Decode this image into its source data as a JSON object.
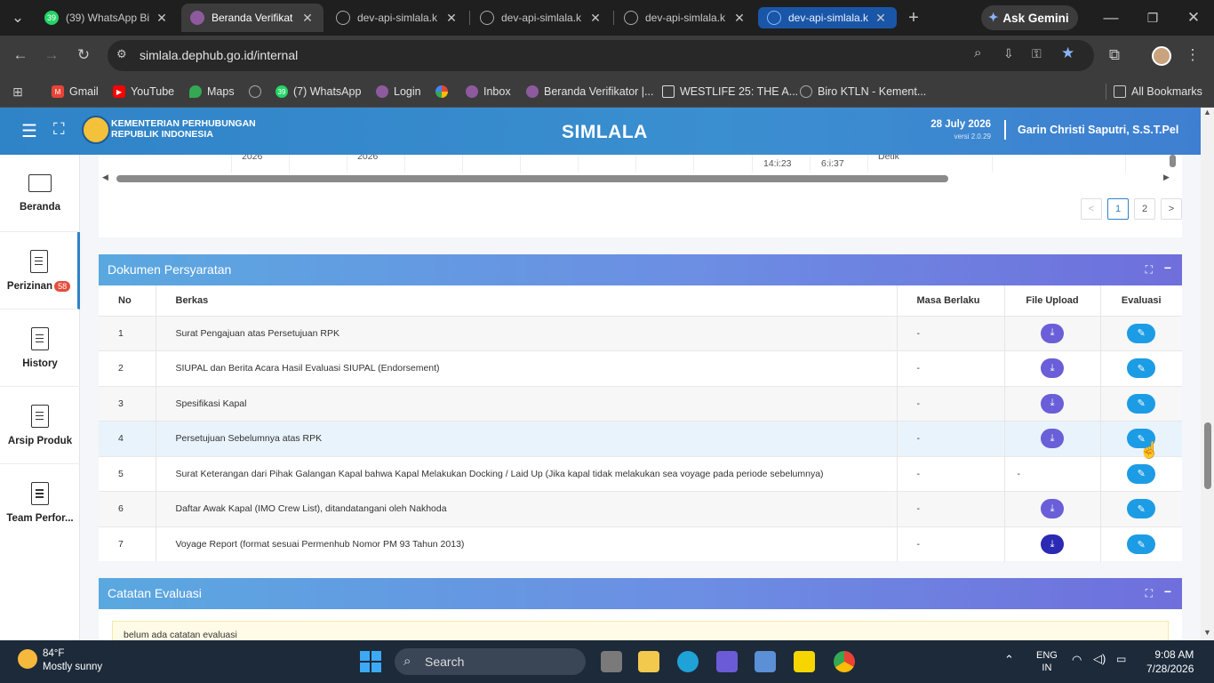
{
  "browser": {
    "tabs": [
      {
        "title": "(39) WhatsApp Bi",
        "favicon": "whatsapp-icon",
        "color": "#25d366",
        "badge": "39"
      },
      {
        "title": "Beranda Verifikat",
        "favicon": "simlala-icon",
        "color": "#8e5a9e",
        "badge": ""
      },
      {
        "title": "dev-api-simlala.k",
        "favicon": "globe-icon",
        "color": "#777777",
        "badge": ""
      },
      {
        "title": "dev-api-simlala.k",
        "favicon": "globe-icon",
        "color": "#777777",
        "badge": ""
      },
      {
        "title": "dev-api-simlala.k",
        "favicon": "globe-icon",
        "color": "#777777",
        "badge": ""
      },
      {
        "title": "dev-api-simlala.k",
        "favicon": "globe-icon",
        "color": "#8ab4f8",
        "badge": ""
      }
    ],
    "new_tab": "+",
    "gemini_label": "Ask Gemini",
    "url": "simlala.dephub.go.id/internal",
    "bookmarks": [
      {
        "label": "Gmail",
        "icon": "gmail-icon",
        "color": "#ea4335"
      },
      {
        "label": "YouTube",
        "icon": "youtube-icon",
        "color": "#ff0000"
      },
      {
        "label": "Maps",
        "icon": "maps-icon",
        "color": "#34a853"
      },
      {
        "label": "",
        "icon": "globe-icon",
        "color": "#888888"
      },
      {
        "label": "(7) WhatsApp",
        "icon": "whatsapp-icon",
        "color": "#25d366"
      },
      {
        "label": "Login",
        "icon": "simlala-icon",
        "color": "#8e5a9e"
      },
      {
        "label": "",
        "icon": "pinwheel-icon",
        "color": "#f4b400"
      },
      {
        "label": "Inbox",
        "icon": "simlala-icon",
        "color": "#8e5a9e"
      },
      {
        "label": "Beranda Verifikator |...",
        "icon": "simlala-icon",
        "color": "#8e5a9e"
      },
      {
        "label": "WESTLIFE 25: THE A...",
        "icon": "page-icon",
        "color": "#dddddd"
      },
      {
        "label": "Biro KTLN - Kement...",
        "icon": "globe-icon",
        "color": "#888888"
      }
    ],
    "all_bookmarks": "All Bookmarks"
  },
  "app": {
    "ministry_line1": "KEMENTERIAN PERHUBUNGAN",
    "ministry_line2": "REPUBLIK INDONESIA",
    "title": "SIMLALA",
    "date": "28 July 2026",
    "version": "versi 2.0.29",
    "user": "Garin Christi Saputri, S.S.T.Pel"
  },
  "sidebar": {
    "items": [
      {
        "label": "Beranda",
        "icon": "monitor-icon",
        "badge": ""
      },
      {
        "label": "Perizinan",
        "icon": "document-icon",
        "badge": "58"
      },
      {
        "label": "History",
        "icon": "document-icon",
        "badge": ""
      },
      {
        "label": "Arsip Produk",
        "icon": "document-icon",
        "badge": ""
      },
      {
        "label": "Team Perfor...",
        "icon": "document-icon",
        "badge": ""
      }
    ]
  },
  "top_table_fragment": {
    "cells": [
      "2026",
      "2026",
      "14:i:23",
      "6:i:37",
      "Detik"
    ]
  },
  "pagination": {
    "prev": "<",
    "pages": [
      "1",
      "2"
    ],
    "next": ">",
    "current": "1"
  },
  "dokumen": {
    "title": "Dokumen Persyaratan",
    "columns": [
      "No",
      "Berkas",
      "Masa Berlaku",
      "File Upload",
      "Evaluasi"
    ],
    "rows": [
      {
        "no": "1",
        "berkas": "Surat Pengajuan atas Persetujuan RPK",
        "masa": "-",
        "upload": "download"
      },
      {
        "no": "2",
        "berkas": "SIUPAL dan Berita Acara Hasil Evaluasi SIUPAL (Endorsement)",
        "masa": "-",
        "upload": "download"
      },
      {
        "no": "3",
        "berkas": "Spesifikasi Kapal",
        "masa": "-",
        "upload": "download"
      },
      {
        "no": "4",
        "berkas": "Persetujuan Sebelumnya atas RPK",
        "masa": "-",
        "upload": "download"
      },
      {
        "no": "5",
        "berkas": "Surat Keterangan dari Pihak Galangan Kapal bahwa Kapal Melakukan Docking / Laid Up (Jika kapal tidak melakukan sea voyage pada periode sebelumnya)",
        "masa": "-",
        "upload": "-"
      },
      {
        "no": "6",
        "berkas": "Daftar Awak Kapal (IMO Crew List), ditandatangani oleh Nakhoda",
        "masa": "-",
        "upload": "download"
      },
      {
        "no": "7",
        "berkas": "Voyage Report (format sesuai Permenhub Nomor PM 93 Tahun 2013)",
        "masa": "-",
        "upload": "download"
      }
    ]
  },
  "catatan": {
    "title": "Catatan Evaluasi",
    "empty_text": "belum ada catatan evaluasi"
  },
  "taskbar": {
    "temp": "84°F",
    "weather": "Mostly sunny",
    "search_placeholder": "Search",
    "lang1": "ENG",
    "lang2": "IN",
    "time": "9:08 AM",
    "date": "7/28/2026"
  },
  "colors": {
    "header_blue": "#2f83c7",
    "card_head_start": "#5aa8e0",
    "card_head_end": "#6f6fdc",
    "download_btn": "#6a5fd8",
    "edit_btn": "#1d9ce6",
    "badge_red": "#e74c3c"
  }
}
